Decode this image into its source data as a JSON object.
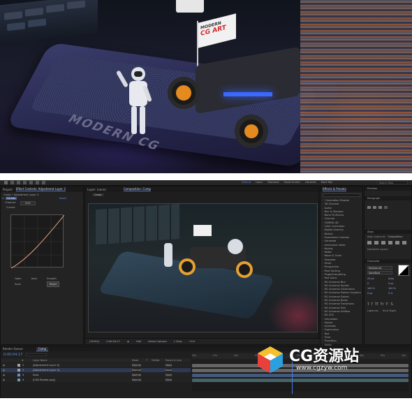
{
  "render": {
    "flag_line1": "MODERN",
    "flag_line2": "CG ART",
    "plate_text": "MODERN CG"
  },
  "menu": {
    "workspaces": [
      "Default",
      "Learn",
      "Standard",
      "Small Screen",
      "Libraries",
      "Start Rev"
    ],
    "search_label": "Search Help"
  },
  "project_panel": {
    "tabs": [
      "Project",
      "Effect Controls: Adjustment Layer 3"
    ],
    "breadcrumb": "Comp • Adjustment Layer 3",
    "effect_name": "Curves",
    "channel_label": "Channel:",
    "channel_value": "RGB",
    "reset_label": "Reset",
    "curves_label": "Curves",
    "curve_buttons": [
      "Open",
      "Auto",
      "Smooth"
    ],
    "save_label": "Save",
    "reset_btn": "Reset"
  },
  "comp_panel": {
    "tabs": [
      "Layer: (none)",
      "Composition: Comp"
    ],
    "comp_tab": "Comp",
    "footer": {
      "zoom": "(39.8%)",
      "timecode": "0:00:04:17",
      "resolution": "Half",
      "camera": "Active Camera",
      "views": "1 View",
      "offset": "+0.0"
    }
  },
  "effects_panel": {
    "title": "Effects & Presets",
    "search_placeholder": "",
    "items": [
      "* Animation Presets",
      "3D Channel",
      "Audio",
      "Blur & Sharpen",
      "Boris FX Mocha",
      "Channel",
      "CINEMA 4D",
      "Color Correction",
      "Digital Anarchy",
      "Distort",
      "Expression Controls",
      "Generate",
      "Immersive Video",
      "Keying",
      "Matte",
      "Noise & Grain",
      "Obsolete",
      "Other",
      "Perspective",
      "Pixel Sorting",
      "PluginEverything",
      "Red Giant",
      "RG Universe Blur",
      "RG Universe Stylize",
      "RG Universe Generators",
      "RG Universe Motion Graphics",
      "RG Universe Distort",
      "RG Universe Noise",
      "RG Universe Transitions",
      "RG Universe Text",
      "RG Universe Utilities",
      "RG VFX",
      "Simulation",
      "Stylize",
      "Synthetic",
      "Supercomp",
      "Text",
      "Time",
      "Transition",
      "Utility"
    ]
  },
  "right_panels": {
    "preview": "Preview",
    "paragraph": "Paragraph",
    "align": "Align",
    "align_to_label": "Align Layers to:",
    "align_to_value": "Composition",
    "distribute_label": "Distribute Layers:",
    "character": "Character",
    "font": "Montserrat",
    "font_style": "SemiBold",
    "size": "25 px",
    "leading": "Auto",
    "tracking": "0",
    "stroke": "0 px",
    "scale_v": "100 %",
    "scale_h": "100 %",
    "baseline": "0 px",
    "tsume": "0 %",
    "ligatures": "Ligatures",
    "hindi": "Hindi Digits"
  },
  "timeline": {
    "tabs": [
      "Render Queue",
      "Comp"
    ],
    "timecode": "0:00:04:17",
    "columns": [
      "#",
      "Layer Name",
      "Mode",
      "T",
      "TrkMat",
      "Parent & Link"
    ],
    "layers": [
      {
        "num": "1",
        "name": "[Adjustment Layer 4]",
        "mode": "Normal",
        "parent": "None",
        "color": "#a4a4a4"
      },
      {
        "num": "2",
        "name": "[Adjustment Layer 3]",
        "mode": "Normal",
        "parent": "None",
        "color": "#a4a4a4"
      },
      {
        "num": "3",
        "name": "Dust",
        "mode": "Normal",
        "parent": "None",
        "color": "#6a8cc8"
      },
      {
        "num": "4",
        "name": "[C4D Render.png]",
        "mode": "Normal",
        "parent": "None",
        "color": "#6aa0a8"
      }
    ],
    "ruler": [
      "00s",
      "01s",
      "02s",
      "03s",
      "04s",
      "05s",
      "06s",
      "07s",
      "08s",
      "09s",
      "10s"
    ],
    "playhead_fraction": 0.46
  },
  "watermark": {
    "brand": "CG资源站",
    "url": "www.cgzyw.com"
  }
}
